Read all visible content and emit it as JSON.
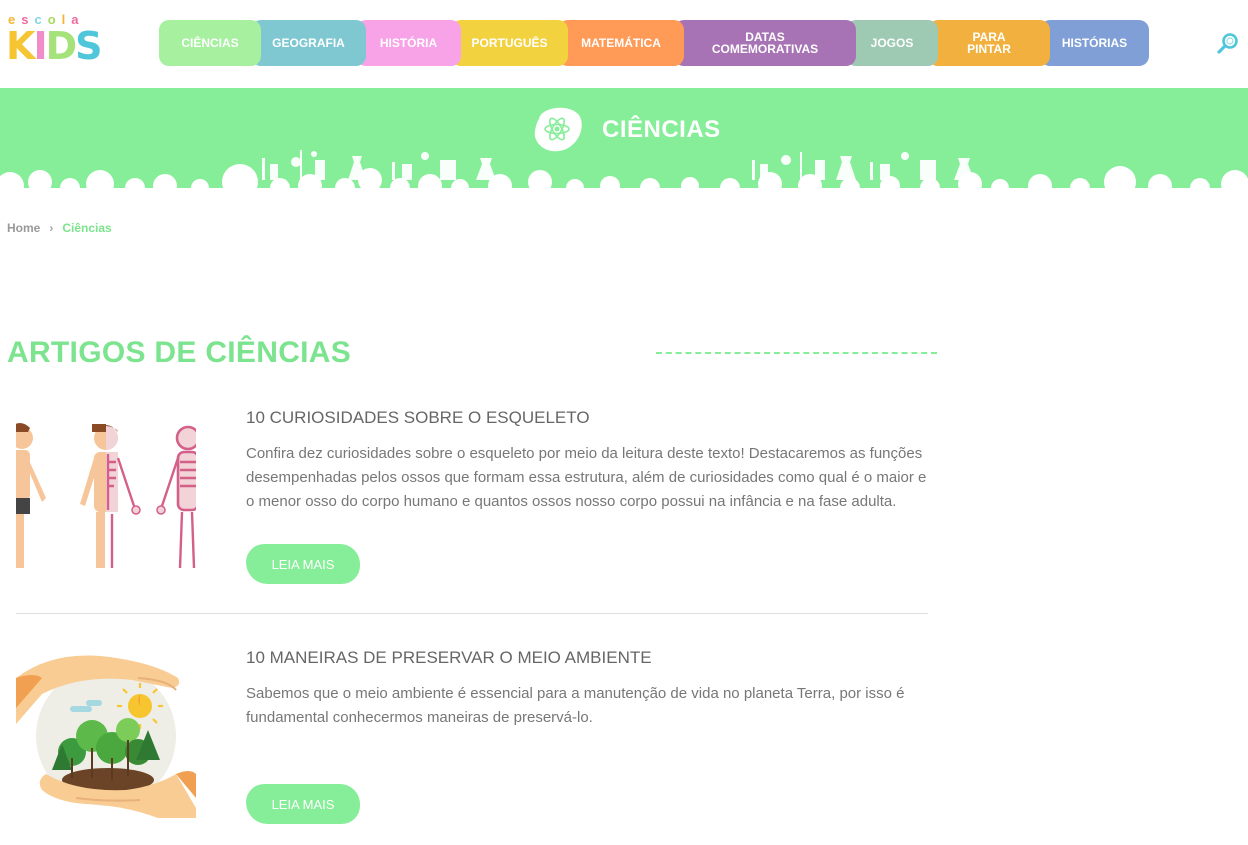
{
  "header": {
    "logo": {
      "top_letters": [
        "e",
        "s",
        "c",
        "o",
        "l",
        "a"
      ],
      "main_letters": [
        "K",
        "I",
        "D",
        "S"
      ]
    },
    "nav": [
      {
        "label": "CIÊNCIAS",
        "color": "#a6f0a0",
        "width": 102
      },
      {
        "label": "GEOGRAFIA",
        "color": "#7fc8d2",
        "width": 115
      },
      {
        "label": "HISTÓRIA",
        "color": "#f8a3e8",
        "width": 105
      },
      {
        "label": "PORTUGUÊS",
        "color": "#f3d240",
        "width": 117
      },
      {
        "label": "MATEMÁTICA",
        "color": "#ff9a57",
        "width": 126
      },
      {
        "label": "DATAS\nCOMEMORATIVAS",
        "color": "#a873b5",
        "width": 182
      },
      {
        "label": "JOGOS",
        "color": "#9ec9b2",
        "width": 92
      },
      {
        "label": "PARA\nPINTAR",
        "color": "#f2b13e",
        "width": 122
      },
      {
        "label": "HISTÓRIAS",
        "color": "#7f9fd6",
        "width": 109
      }
    ],
    "search_icon": "search-icon",
    "search_color": "#4fc6d9"
  },
  "banner": {
    "title": "CIÊNCIAS",
    "icon": "atom-icon",
    "background": "#86ee98"
  },
  "breadcrumb": {
    "home": "Home",
    "separator": "›",
    "current": "Ciências"
  },
  "section": {
    "title": "ARTIGOS DE CIÊNCIAS",
    "accent": "#7ce38e"
  },
  "articles": [
    {
      "title": "10 CURIOSIDADES SOBRE O ESQUELETO",
      "text": "Confira dez curiosidades sobre o esqueleto por meio da leitura deste texto! Destacaremos as funções desempenhadas pelos ossos que formam essa estrutura, além de curiosidades como qual é o maior e o menor osso do corpo humano e quantos ossos nosso corpo possui na infância e na fase adulta.",
      "button": "LEIA MAIS",
      "image": "skeleton-illustration"
    },
    {
      "title": "10 MANEIRAS DE PRESERVAR O MEIO AMBIENTE",
      "text": "Sabemos que o meio ambiente é essencial para a manutenção de vida no planeta Terra, por isso é fundamental conhecermos maneiras de preservá-lo.",
      "button": "LEIA MAIS",
      "image": "environment-illustration"
    }
  ]
}
